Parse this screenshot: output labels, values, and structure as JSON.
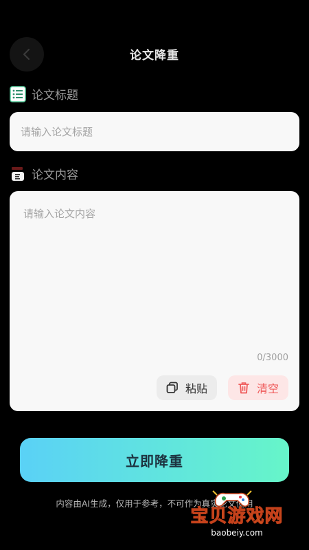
{
  "header": {
    "title": "论文降重",
    "back_icon": "chevron-left-icon"
  },
  "title_section": {
    "label": "论文标题",
    "icon": "list-icon",
    "placeholder": "请输入论文标题"
  },
  "content_section": {
    "label": "论文内容",
    "icon": "document-icon",
    "placeholder": "请输入论文内容",
    "char_count": "0/3000"
  },
  "actions": {
    "paste_label": "粘贴",
    "paste_icon": "copy-icon",
    "clear_label": "清空",
    "clear_icon": "trash-icon"
  },
  "submit": {
    "label": "立即降重"
  },
  "footer": {
    "disclaimer": "内容由AI生成，仅用于参考，不可作为真实论文使用"
  },
  "watermark": {
    "text": "宝贝游戏网",
    "url": "baobeiy.com"
  },
  "colors": {
    "background": "#000000",
    "card": "#f8f8f8",
    "gradient_start": "#5ad1f6",
    "gradient_end": "#66f5c9",
    "clear_accent": "#ef5a5a"
  }
}
